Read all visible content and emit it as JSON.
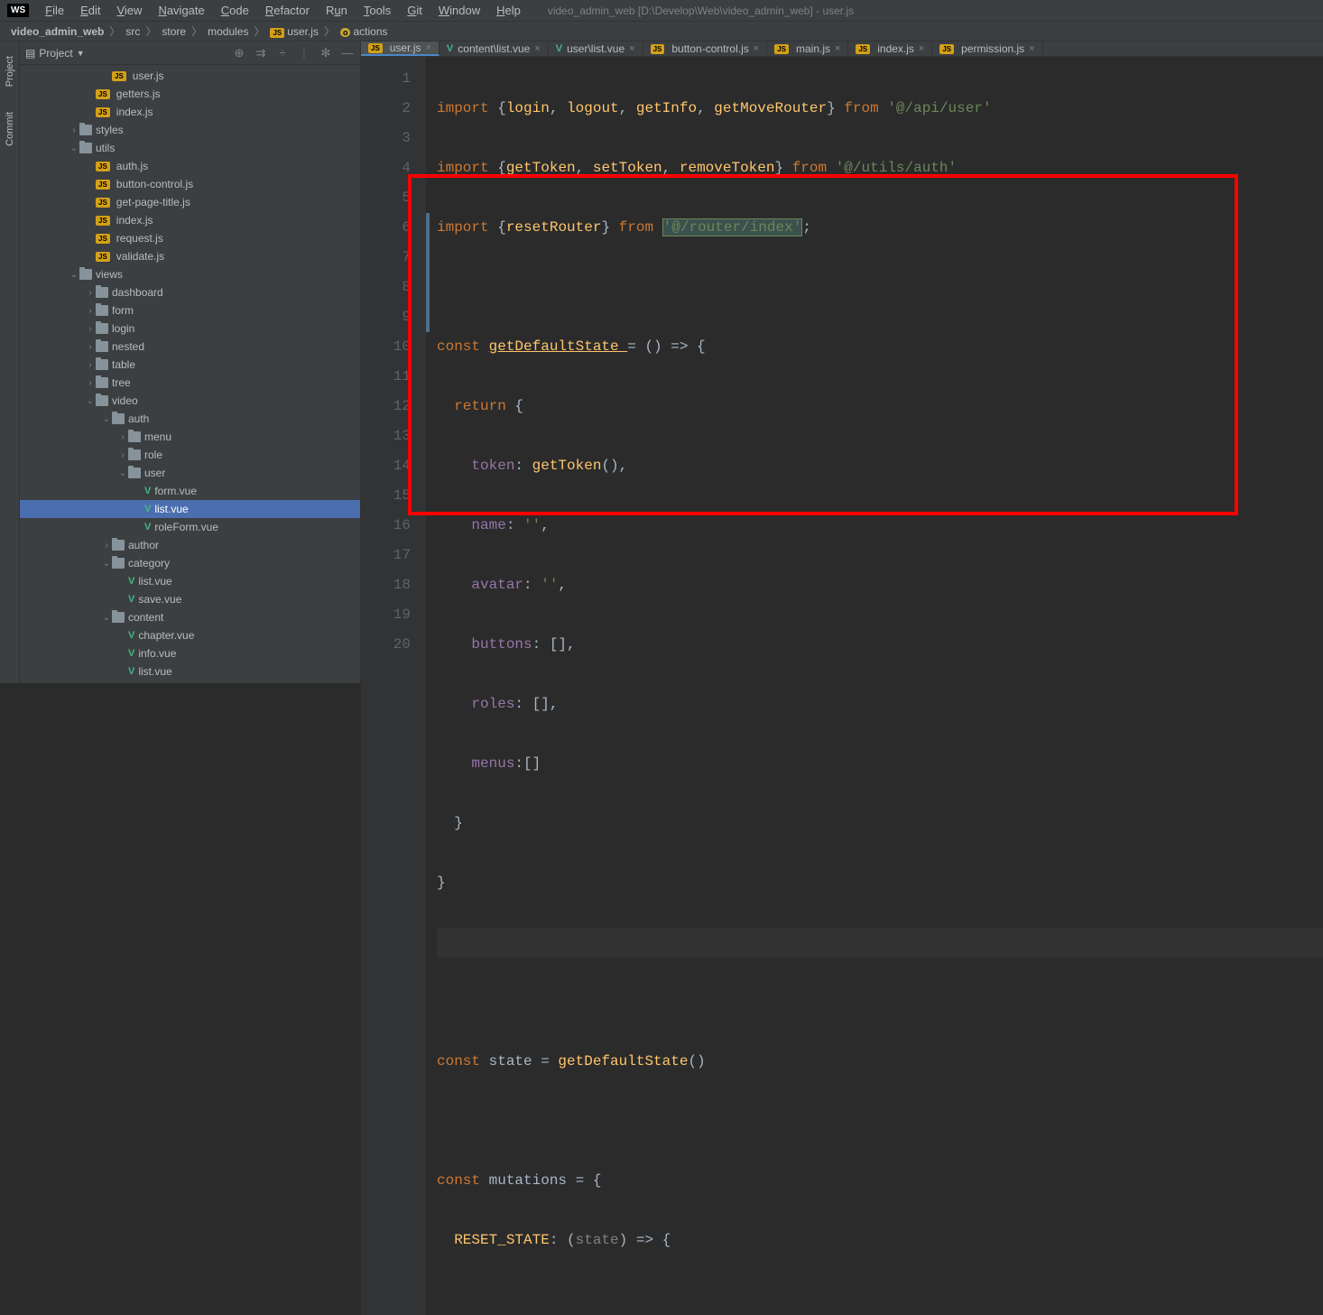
{
  "window": {
    "title": "video_admin_web [D:\\Develop\\Web\\video_admin_web] - user.js",
    "badge": "WS"
  },
  "menu": [
    "File",
    "Edit",
    "View",
    "Navigate",
    "Code",
    "Refactor",
    "Run",
    "Tools",
    "Git",
    "Window",
    "Help"
  ],
  "breadcrumb": [
    "video_admin_web",
    "src",
    "store",
    "modules",
    "user.js",
    "actions"
  ],
  "project": {
    "title": "Project"
  },
  "tree": [
    {
      "indent": 5,
      "type": "js",
      "label": "user.js",
      "arrow": ""
    },
    {
      "indent": 4,
      "type": "js",
      "label": "getters.js",
      "arrow": ""
    },
    {
      "indent": 4,
      "type": "js",
      "label": "index.js",
      "arrow": ""
    },
    {
      "indent": 3,
      "type": "folder",
      "label": "styles",
      "arrow": ">"
    },
    {
      "indent": 3,
      "type": "folder",
      "label": "utils",
      "arrow": "v"
    },
    {
      "indent": 4,
      "type": "js",
      "label": "auth.js",
      "arrow": ""
    },
    {
      "indent": 4,
      "type": "js",
      "label": "button-control.js",
      "arrow": ""
    },
    {
      "indent": 4,
      "type": "js",
      "label": "get-page-title.js",
      "arrow": ""
    },
    {
      "indent": 4,
      "type": "js",
      "label": "index.js",
      "arrow": ""
    },
    {
      "indent": 4,
      "type": "js",
      "label": "request.js",
      "arrow": ""
    },
    {
      "indent": 4,
      "type": "js",
      "label": "validate.js",
      "arrow": ""
    },
    {
      "indent": 3,
      "type": "folder",
      "label": "views",
      "arrow": "v"
    },
    {
      "indent": 4,
      "type": "folder",
      "label": "dashboard",
      "arrow": ">"
    },
    {
      "indent": 4,
      "type": "folder",
      "label": "form",
      "arrow": ">"
    },
    {
      "indent": 4,
      "type": "folder",
      "label": "login",
      "arrow": ">"
    },
    {
      "indent": 4,
      "type": "folder",
      "label": "nested",
      "arrow": ">"
    },
    {
      "indent": 4,
      "type": "folder",
      "label": "table",
      "arrow": ">"
    },
    {
      "indent": 4,
      "type": "folder",
      "label": "tree",
      "arrow": ">"
    },
    {
      "indent": 4,
      "type": "folder",
      "label": "video",
      "arrow": "v"
    },
    {
      "indent": 5,
      "type": "folder",
      "label": "auth",
      "arrow": "v"
    },
    {
      "indent": 6,
      "type": "folder",
      "label": "menu",
      "arrow": ">"
    },
    {
      "indent": 6,
      "type": "folder",
      "label": "role",
      "arrow": ">"
    },
    {
      "indent": 6,
      "type": "folder",
      "label": "user",
      "arrow": "v"
    },
    {
      "indent": 7,
      "type": "vue",
      "label": "form.vue",
      "arrow": ""
    },
    {
      "indent": 7,
      "type": "vue",
      "label": "list.vue",
      "arrow": "",
      "selected": true
    },
    {
      "indent": 7,
      "type": "vue",
      "label": "roleForm.vue",
      "arrow": ""
    },
    {
      "indent": 5,
      "type": "folder",
      "label": "author",
      "arrow": ">"
    },
    {
      "indent": 5,
      "type": "folder",
      "label": "category",
      "arrow": "v"
    },
    {
      "indent": 6,
      "type": "vue",
      "label": "list.vue",
      "arrow": ""
    },
    {
      "indent": 6,
      "type": "vue",
      "label": "save.vue",
      "arrow": ""
    },
    {
      "indent": 5,
      "type": "folder",
      "label": "content",
      "arrow": "v"
    },
    {
      "indent": 6,
      "type": "vue",
      "label": "chapter.vue",
      "arrow": ""
    },
    {
      "indent": 6,
      "type": "vue",
      "label": "info.vue",
      "arrow": ""
    },
    {
      "indent": 6,
      "type": "vue",
      "label": "list.vue",
      "arrow": ""
    }
  ],
  "tabs": [
    {
      "type": "js",
      "label": "user.js",
      "active": true
    },
    {
      "type": "vue",
      "label": "content\\list.vue"
    },
    {
      "type": "vue",
      "label": "user\\list.vue"
    },
    {
      "type": "js",
      "label": "button-control.js"
    },
    {
      "type": "js",
      "label": "main.js"
    },
    {
      "type": "js",
      "label": "index.js"
    },
    {
      "type": "js",
      "label": "permission.js"
    }
  ],
  "code": {
    "lines": [
      1,
      2,
      3,
      4,
      5,
      6,
      7,
      8,
      9,
      10,
      11,
      12,
      13,
      14,
      15,
      16,
      17,
      18,
      19,
      20
    ],
    "line1_a": "import",
    "line1_b": "{",
    "line1_c": "login",
    "line1_d": ", ",
    "line1_e": "logout",
    "line1_f": ", ",
    "line1_g": "getInfo",
    "line1_h": ", ",
    "line1_i": "getMoveRouter",
    "line1_j": "} ",
    "line1_k": "from ",
    "line1_l": "'@/api/user'",
    "line2_a": "import ",
    "line2_b": "{",
    "line2_c": "getToken",
    "line2_d": ", ",
    "line2_e": "setToken",
    "line2_f": ", ",
    "line2_g": "removeToken",
    "line2_h": "} ",
    "line2_i": "from ",
    "line2_j": "'@/utils/auth'",
    "line3_a": "import ",
    "line3_b": "{",
    "line3_c": "resetRouter",
    "line3_d": "} ",
    "line3_e": "from ",
    "line3_f": "'@/router/index'",
    "line3_g": ";",
    "line5_a": "const ",
    "line5_b": "getDefaultState ",
    "line5_c": "= () => {",
    "line6_a": "  return ",
    "line6_b": "{",
    "line7_a": "    ",
    "line7_b": "token",
    "line7_c": ": ",
    "line7_d": "getToken",
    "line7_e": "(),",
    "line8_a": "    ",
    "line8_b": "name",
    "line8_c": ": ",
    "line8_d": "''",
    "line8_e": ",",
    "line9_a": "    ",
    "line9_b": "avatar",
    "line9_c": ": ",
    "line9_d": "''",
    "line9_e": ",",
    "line10_a": "    ",
    "line10_b": "buttons",
    "line10_c": ": [],",
    "line11_a": "    ",
    "line11_b": "roles",
    "line11_c": ": [],",
    "line12_a": "    ",
    "line12_b": "menus",
    "line12_c": ":[]",
    "line13": "  }",
    "line14": "}",
    "line17_a": "const ",
    "line17_b": "state ",
    "line17_c": "= ",
    "line17_d": "getDefaultState",
    "line17_e": "()",
    "line19_a": "const ",
    "line19_b": "mutations ",
    "line19_c": "= {",
    "line20_a": "  ",
    "line20_b": "RESET_STATE",
    "line20_c": ": (",
    "line20_d": "state",
    "line20_e": ") => {"
  },
  "sidebar_tabs": [
    "Project",
    "Commit"
  ]
}
